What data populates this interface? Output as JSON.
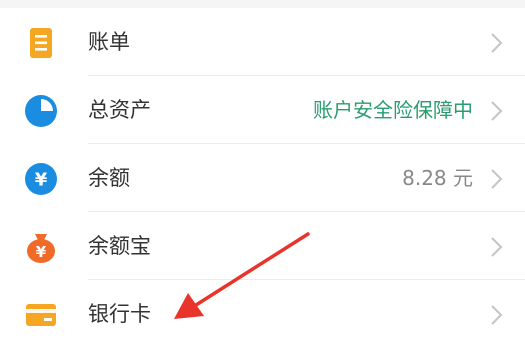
{
  "menu": {
    "items": [
      {
        "label": "账单",
        "value": "",
        "icon": "bill-icon",
        "icon_color": "#f5a623"
      },
      {
        "label": "总资产",
        "value": "账户安全险保障中",
        "icon": "pie-chart-icon",
        "icon_color": "#1a8de0"
      },
      {
        "label": "余额",
        "value": "8.28 元",
        "icon": "yuan-coin-icon",
        "icon_color": "#1a8de0"
      },
      {
        "label": "余额宝",
        "value": "",
        "icon": "money-bag-icon",
        "icon_color": "#f06b27"
      },
      {
        "label": "银行卡",
        "value": "",
        "icon": "bank-card-icon",
        "icon_color": "#f5a623"
      }
    ]
  },
  "colors": {
    "accent_green": "#2a9c6f",
    "annotation_red": "#e8342a",
    "chevron": "#c4c4c4"
  }
}
